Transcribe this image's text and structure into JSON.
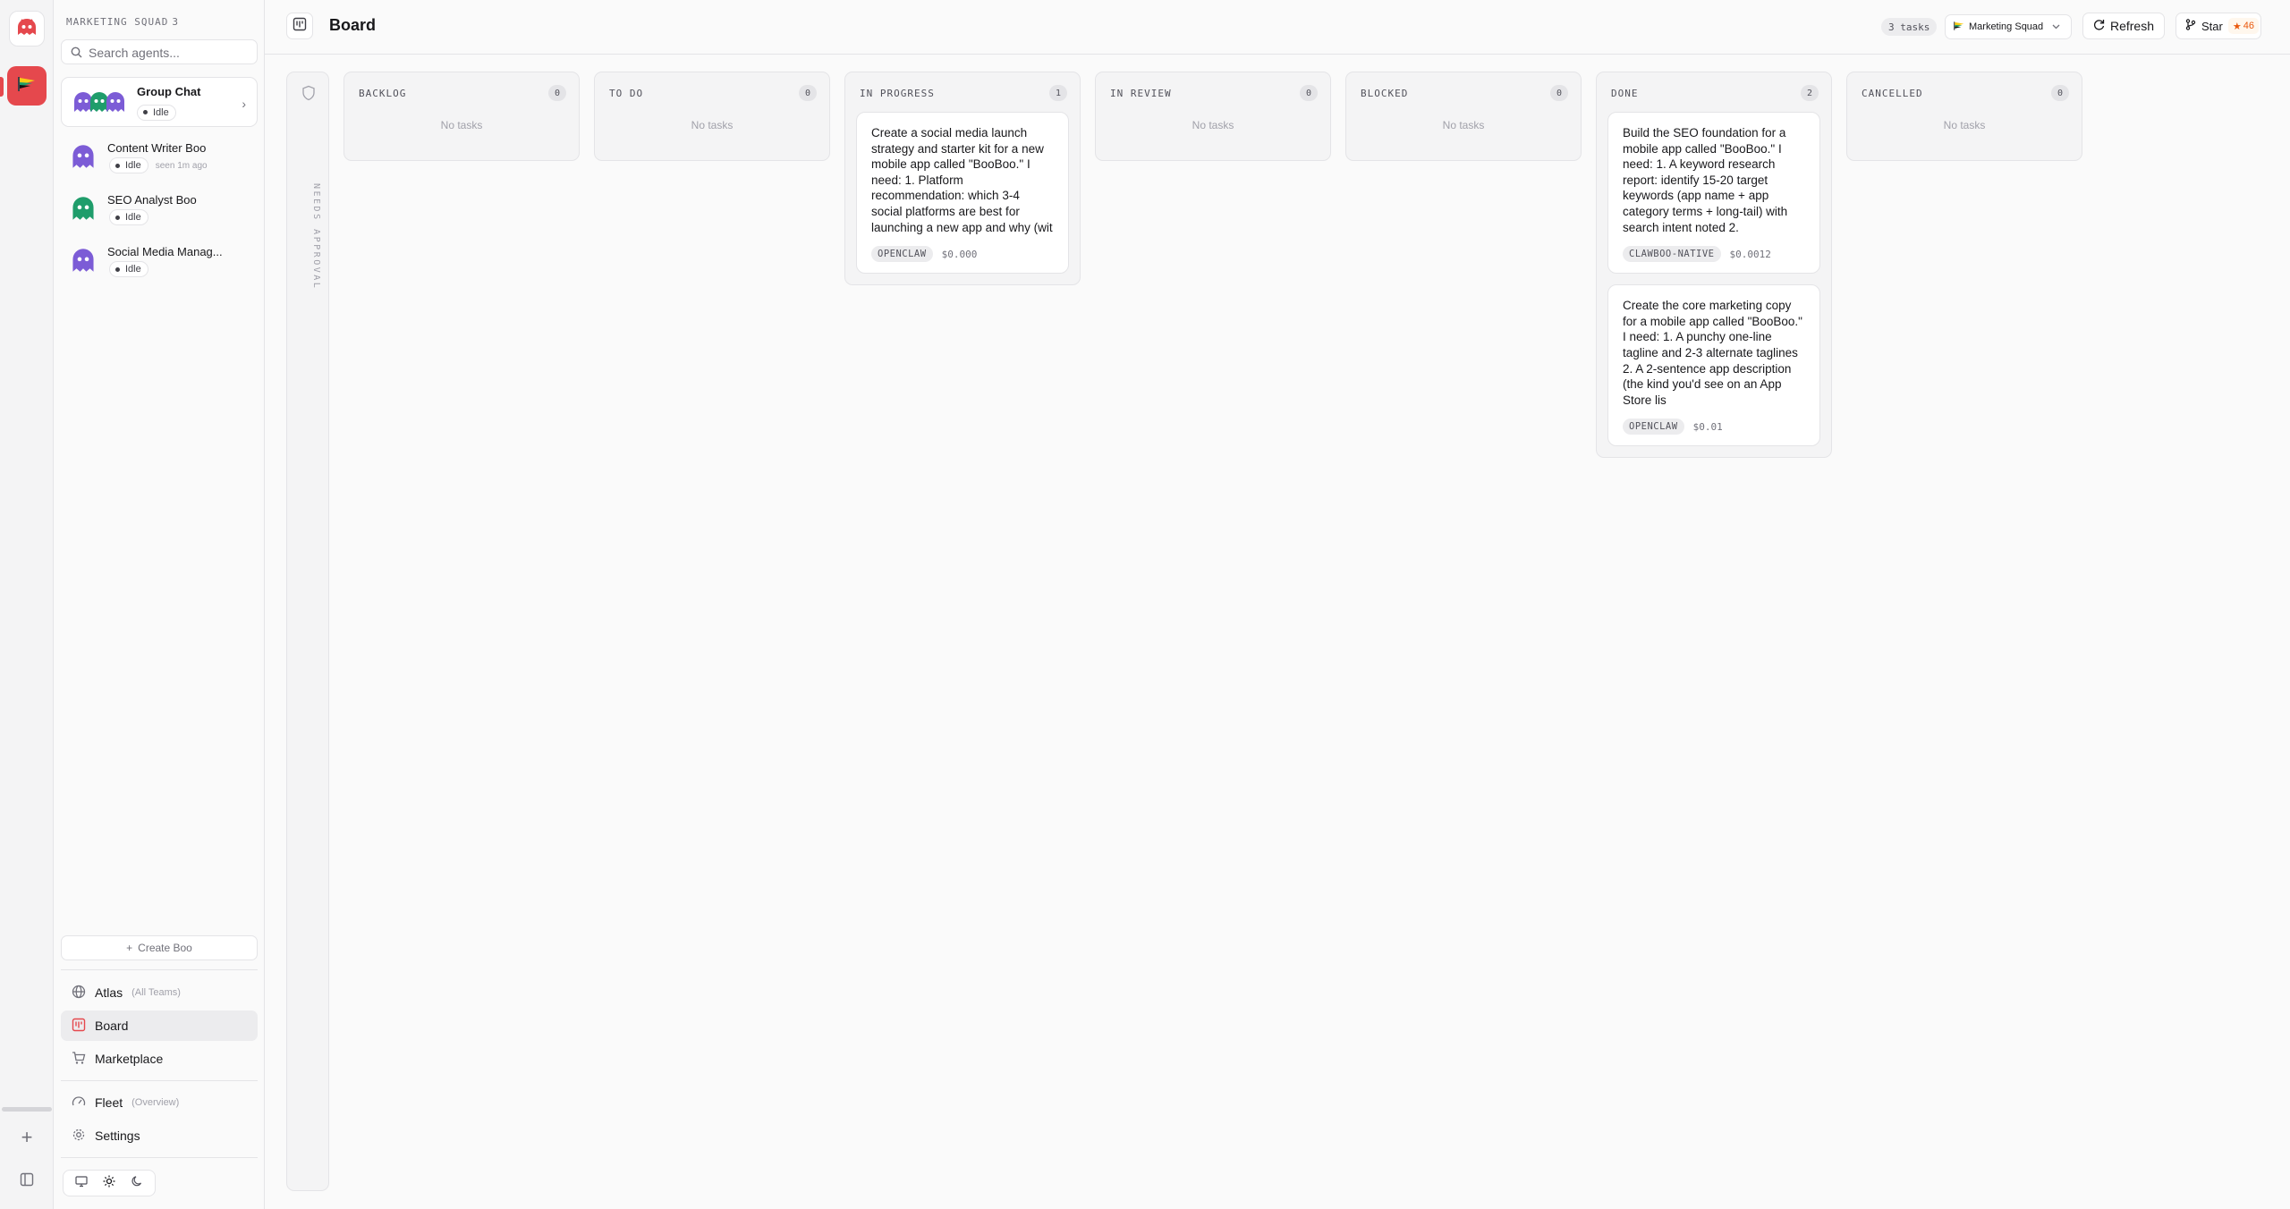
{
  "team": {
    "label": "MARKETING SQUAD",
    "count": "3"
  },
  "search": {
    "placeholder": "Search agents..."
  },
  "group_chat": {
    "title": "Group Chat",
    "status": "Idle"
  },
  "agents": [
    {
      "name": "Content Writer Boo",
      "status": "Idle",
      "seen": "seen 1m ago"
    },
    {
      "name": "SEO Analyst Boo",
      "status": "Idle",
      "seen": ""
    },
    {
      "name": "Social Media Manag...",
      "status": "Idle",
      "seen": ""
    }
  ],
  "sidebar": {
    "create_label": "Create Boo",
    "nav": {
      "atlas": {
        "label": "Atlas",
        "sub": "(All Teams)"
      },
      "board": {
        "label": "Board"
      },
      "marketplace": {
        "label": "Marketplace"
      },
      "fleet": {
        "label": "Fleet",
        "sub": "(Overview)"
      },
      "settings": {
        "label": "Settings"
      }
    }
  },
  "header": {
    "title": "Board",
    "tasks_badge": "3 tasks",
    "team_select": "Marketing Squad",
    "refresh_label": "Refresh",
    "star_label": "Star",
    "star_count": "46"
  },
  "board": {
    "approval_label": "NEEDS APPROVAL",
    "empty_text": "No tasks",
    "columns": [
      {
        "title": "BACKLOG",
        "count": "0",
        "cards": []
      },
      {
        "title": "TO DO",
        "count": "0",
        "cards": []
      },
      {
        "title": "IN PROGRESS",
        "count": "1",
        "cards": [
          {
            "text": "Create a social media launch strategy and starter kit for a new mobile app called \"BooBoo.\" I need: 1. Platform recommendation: which 3-4 social platforms are best for launching a new app and why (wit",
            "tag": "OPENCLAW",
            "cost": "$0.000"
          }
        ]
      },
      {
        "title": "IN REVIEW",
        "count": "0",
        "cards": []
      },
      {
        "title": "BLOCKED",
        "count": "0",
        "cards": []
      },
      {
        "title": "DONE",
        "count": "2",
        "cards": [
          {
            "text": "Build the SEO foundation for a mobile app called \"BooBoo.\" I need: 1. A keyword research report: identify 15-20 target keywords (app name + app category terms + long-tail) with search intent noted 2.",
            "tag": "CLAWBOO-NATIVE",
            "cost": "$0.0012"
          },
          {
            "text": "Create the core marketing copy for a mobile app called \"BooBoo.\" I need: 1. A punchy one-line tagline and 2-3 alternate taglines 2. A 2-sentence app description (the kind you'd see on an App Store lis",
            "tag": "OPENCLAW",
            "cost": "$0.01"
          }
        ]
      },
      {
        "title": "CANCELLED",
        "count": "0",
        "cards": []
      }
    ]
  },
  "colors": {
    "accent": "#e5484d",
    "ghost_purple": "#7c5cd6",
    "ghost_green": "#1f9d6b",
    "star_orange": "#ea580c"
  },
  "icons": {
    "logo": "ghost-logo-icon",
    "team": "flag-icon",
    "search": "search-icon",
    "refresh": "refresh-icon",
    "star": "github-icon",
    "board": "kanban-icon"
  }
}
